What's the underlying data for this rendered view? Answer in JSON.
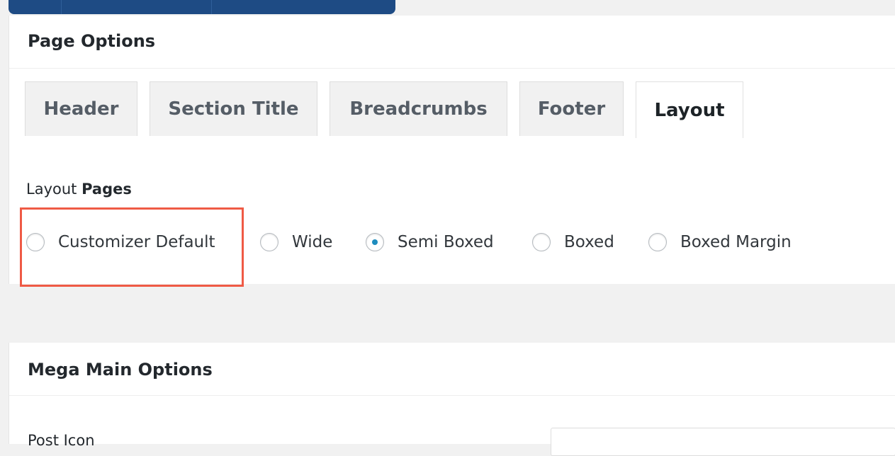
{
  "page_options": {
    "title": "Page Options",
    "tabs": [
      {
        "label": "Header",
        "active": false
      },
      {
        "label": "Section Title",
        "active": false
      },
      {
        "label": "Breadcrumbs",
        "active": false
      },
      {
        "label": "Footer",
        "active": false
      },
      {
        "label": "Layout",
        "active": true
      }
    ],
    "layout_field": {
      "label_prefix": "Layout",
      "label_bold": "Pages",
      "options": [
        {
          "label": "Customizer Default",
          "checked": false
        },
        {
          "label": "Wide",
          "checked": false
        },
        {
          "label": "Semi Boxed",
          "checked": true
        },
        {
          "label": "Boxed",
          "checked": false
        },
        {
          "label": "Boxed Margin",
          "checked": false
        }
      ],
      "highlighted_option": "Customizer Default",
      "highlight_color": "#ef5a45"
    }
  },
  "mega_main_options": {
    "title": "Mega Main Options",
    "post_icon_label": "Post Icon",
    "post_icon_value": ""
  },
  "colors": {
    "top_bar": "#1e4b84",
    "radio_checked": "#1e8cbe"
  }
}
